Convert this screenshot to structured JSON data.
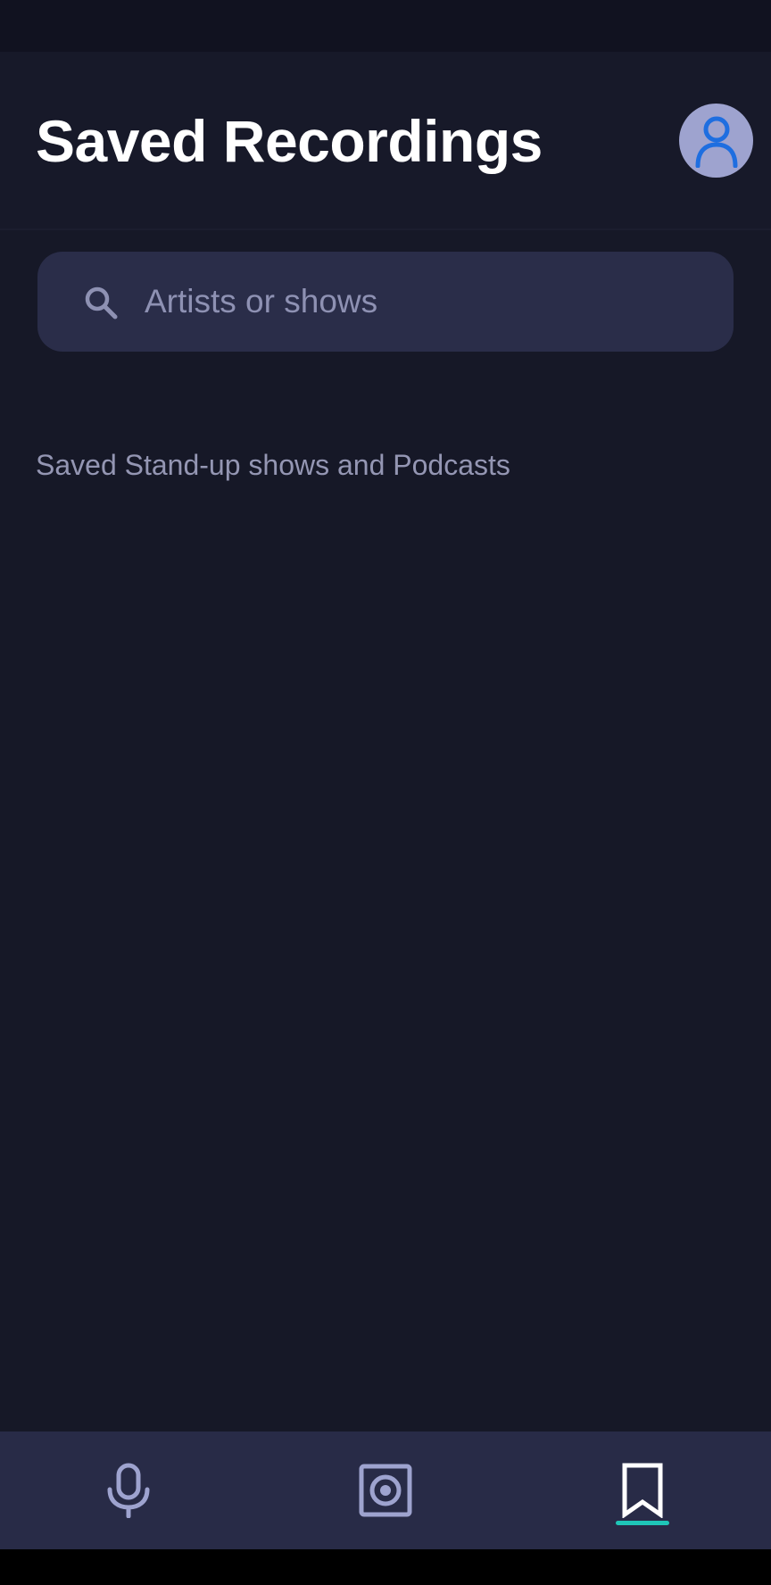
{
  "header": {
    "title": "Saved Recordings"
  },
  "search": {
    "placeholder": "Artists or shows",
    "value": ""
  },
  "section": {
    "label": "Saved Stand-up shows and Podcasts"
  },
  "bottom_nav": {
    "items": [
      {
        "name": "microphone",
        "icon": "microphone-icon",
        "active": false
      },
      {
        "name": "speaker",
        "icon": "speaker-icon",
        "active": false
      },
      {
        "name": "saved",
        "icon": "bookmark-icon",
        "active": true
      }
    ]
  },
  "colors": {
    "background": "#161827",
    "header_background": "#171929",
    "search_background": "#2a2d49",
    "nav_background": "#282b47",
    "icon_muted": "#9ea3cf",
    "avatar_icon": "#1e6ee0",
    "active_indicator": "#1fc6b8",
    "title_text": "#ffffff",
    "secondary_text": "#9496b3"
  }
}
